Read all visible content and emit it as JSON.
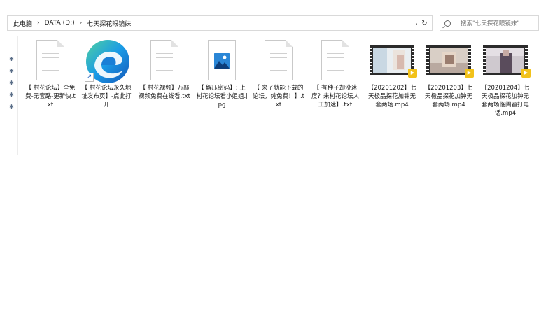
{
  "address_bar": {
    "crumbs": [
      "此电脑",
      "DATA (D:)",
      "七天探花眼镜妹"
    ],
    "separator": "›",
    "dropdown_glyph": "⌄",
    "refresh_glyph": "↻"
  },
  "search": {
    "placeholder": "搜索\"七天探花眼镜妹\"",
    "icon": "search-icon"
  },
  "nav_pane": {
    "pin_glyph": "✱",
    "pin_count": 5
  },
  "files": [
    {
      "type": "txt",
      "label": "【 村花论坛】全免费-无套路-更新快.txt"
    },
    {
      "type": "shortcut",
      "label": "【 村花论坛永久地址发布页】-点此打开"
    },
    {
      "type": "txt",
      "label": "【 村花视频】万部视频免费在线看.txt"
    },
    {
      "type": "jpg",
      "label": "【 解压密码】: 上村花论坛看小姐姐.jpg"
    },
    {
      "type": "txt",
      "label": "【 来了就能下载的论坛，纯免费！】.txt"
    },
    {
      "type": "txt",
      "label": "【 有种子却没速度？来村花论坛人工加速】.txt"
    },
    {
      "type": "video",
      "label": "【20201202】七天极品探花加钟无套两场.mp4"
    },
    {
      "type": "video",
      "label": "【20201203】七天极品探花加钟无套两场.mp4"
    },
    {
      "type": "video",
      "label": "【20201204】七天极品探花加钟无套两场临阖蜜打电话.mp4"
    }
  ],
  "colors": {
    "border": "#d9d9d9",
    "edge_blue": "#1f6fd1",
    "edge_green": "#4fc24a",
    "video_badge": "#f2c21a"
  }
}
